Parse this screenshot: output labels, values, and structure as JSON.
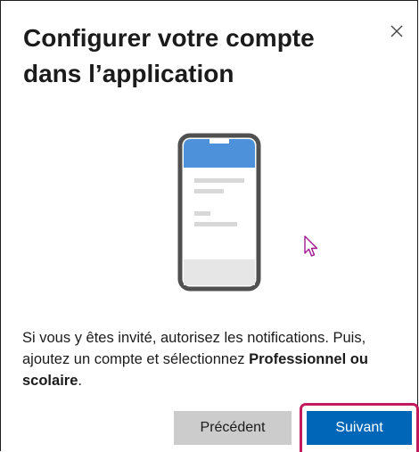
{
  "dialog": {
    "title": "Configurer votre compte dans l’application",
    "close_icon": "close-icon",
    "illustration_icon": "phone-app-icon",
    "instructions": {
      "part1": "Si vous y êtes invité, autorisez les notifications. Puis, ajoutez un compte et sélectionnez ",
      "bold": "Professionnel ou scolaire",
      "part2": "."
    },
    "buttons": {
      "previous_label": "Précédent",
      "next_label": "Suivant"
    }
  },
  "colors": {
    "primary_button": "#0067b8",
    "secondary_button": "#cccccc",
    "focus_highlight": "#c3195d",
    "phone_header": "#4c91d9"
  }
}
